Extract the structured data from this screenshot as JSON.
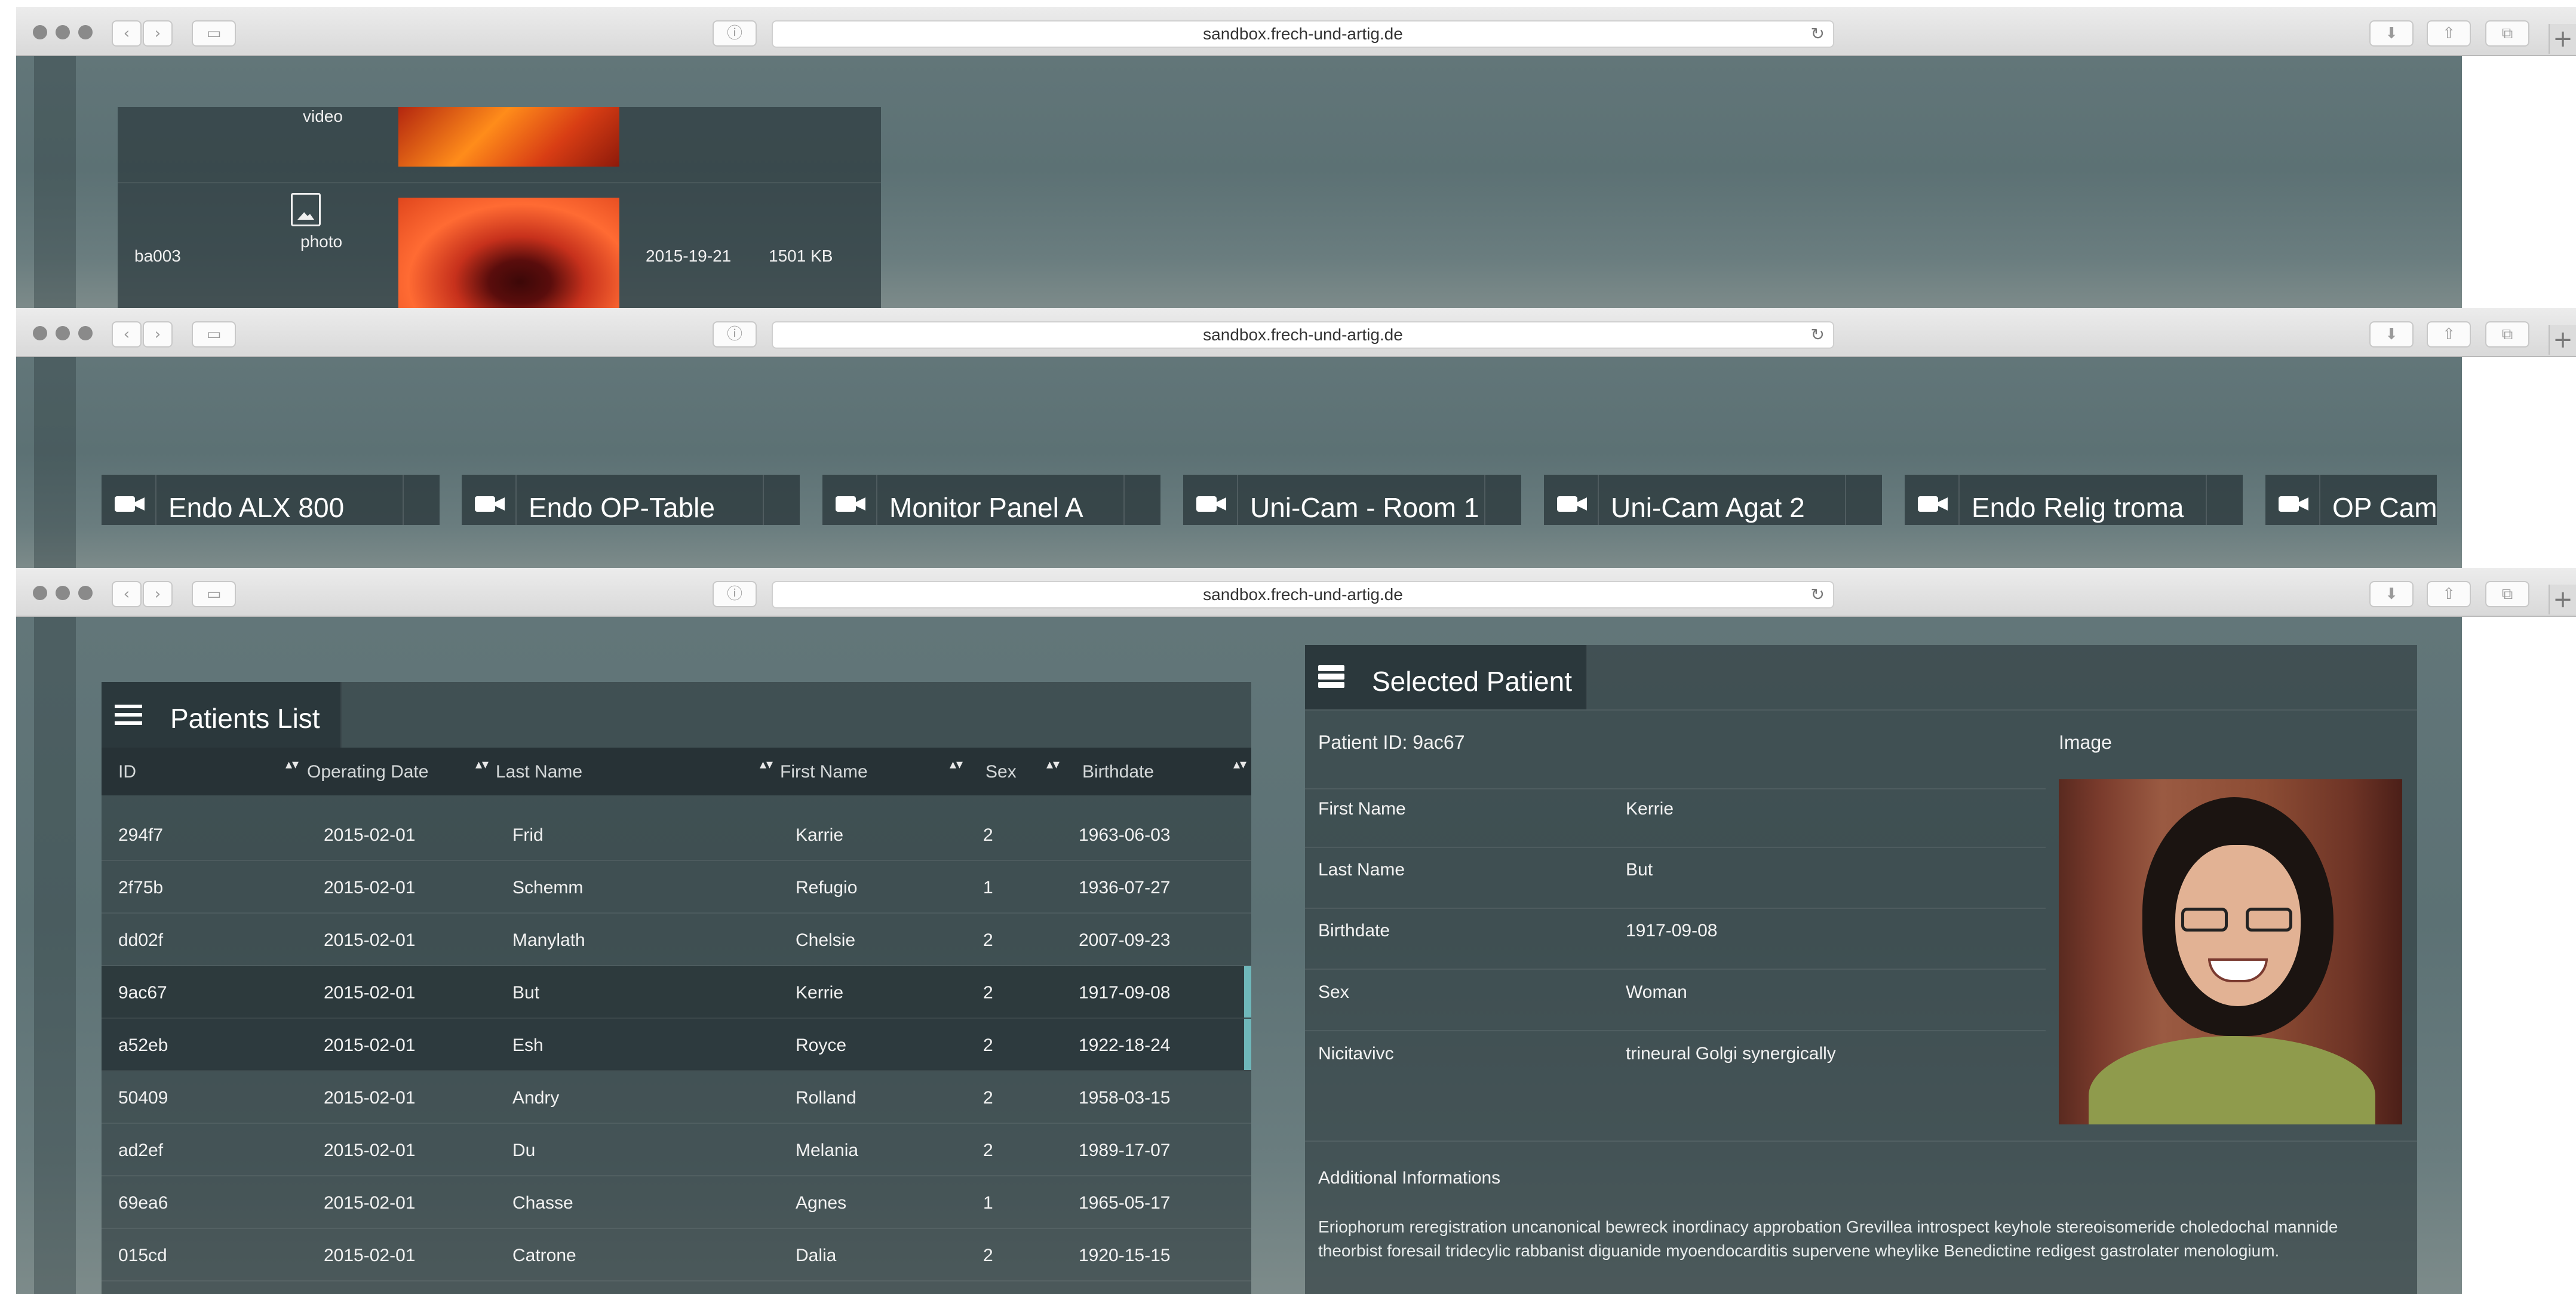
{
  "browser": {
    "url": "sandbox.frech-und-artig.de",
    "back_glyph": "‹",
    "forward_glyph": "›",
    "info_glyph": "ⓘ",
    "reload_glyph": "↻",
    "new_tab_glyph": "+",
    "download_glyph": "⬇",
    "share_glyph": "⇧",
    "tabs_glyph": "⧉",
    "icons": [
      "sidebar-icon",
      "info-icon",
      "reload-icon",
      "download-icon",
      "share-icon",
      "tabs-icon",
      "new-tab-icon"
    ]
  },
  "media_list": {
    "rows": [
      {
        "id": "",
        "type": "video",
        "date": "",
        "size": ""
      },
      {
        "id": "ba003",
        "type": "photo",
        "date": "2015-19-21",
        "size": "1501 KB"
      }
    ]
  },
  "cameras": [
    {
      "label": "Endo ALX 800"
    },
    {
      "label": "Endo OP-Table"
    },
    {
      "label": "Monitor Panel A"
    },
    {
      "label": "Uni-Cam - Room 1"
    },
    {
      "label": "Uni-Cam Agat 2"
    },
    {
      "label": "Endo Relig troma"
    },
    {
      "label": "OP Came"
    }
  ],
  "patients_list": {
    "title": "Patients List",
    "sort_glyph": "▴▾",
    "columns": [
      "ID",
      "Operating Date",
      "Last Name",
      "First Name",
      "Sex",
      "Birthdate"
    ],
    "rows": [
      {
        "id": "294f7",
        "op_date": "2015-02-01",
        "last": "Frid",
        "first": "Karrie",
        "sex": "2",
        "birth": "1963-06-03"
      },
      {
        "id": "2f75b",
        "op_date": "2015-02-01",
        "last": "Schemm",
        "first": "Refugio",
        "sex": "1",
        "birth": "1936-07-27"
      },
      {
        "id": "dd02f",
        "op_date": "2015-02-01",
        "last": "Manylath",
        "first": "Chelsie",
        "sex": "2",
        "birth": "2007-09-23"
      },
      {
        "id": "9ac67",
        "op_date": "2015-02-01",
        "last": "But",
        "first": "Kerrie",
        "sex": "2",
        "birth": "1917-09-08"
      },
      {
        "id": "a52eb",
        "op_date": "2015-02-01",
        "last": "Esh",
        "first": "Royce",
        "sex": "2",
        "birth": "1922-18-24"
      },
      {
        "id": "50409",
        "op_date": "2015-02-01",
        "last": "Andry",
        "first": "Rolland",
        "sex": "2",
        "birth": "1958-03-15"
      },
      {
        "id": "ad2ef",
        "op_date": "2015-02-01",
        "last": "Du",
        "first": "Melania",
        "sex": "2",
        "birth": "1989-17-07"
      },
      {
        "id": "69ea6",
        "op_date": "2015-02-01",
        "last": "Chasse",
        "first": "Agnes",
        "sex": "1",
        "birth": "1965-05-17"
      },
      {
        "id": "015cd",
        "op_date": "2015-02-01",
        "last": "Catrone",
        "first": "Dalia",
        "sex": "2",
        "birth": "1920-15-15"
      }
    ]
  },
  "selected_patient": {
    "title": "Selected Patient",
    "patient_id_label": "Patient ID: 9ac67",
    "image_label": "Image",
    "fields": [
      {
        "label": "First Name",
        "value": "Kerrie"
      },
      {
        "label": "Last Name",
        "value": "But"
      },
      {
        "label": "Birthdate",
        "value": "1917-09-08"
      },
      {
        "label": "Sex",
        "value": "Woman"
      },
      {
        "label": "Nicitavivc",
        "value": "trineural Golgi synergically"
      }
    ],
    "additional_title": "Additional Informations",
    "additional_text": "Eriophorum reregistration uncanonical bewreck inordinacy approbation Grevillea introspect keyhole stereoisomeride choledochal mannide theorbist foresail tridecylic rabbanist diguanide myoendocarditis supervene wheylike Benedictine redigest gastrolater menologium."
  },
  "colors": {
    "accent": "#6fb7ba",
    "panel": "#2d3a3e",
    "chrome": "#e3e3e3"
  }
}
